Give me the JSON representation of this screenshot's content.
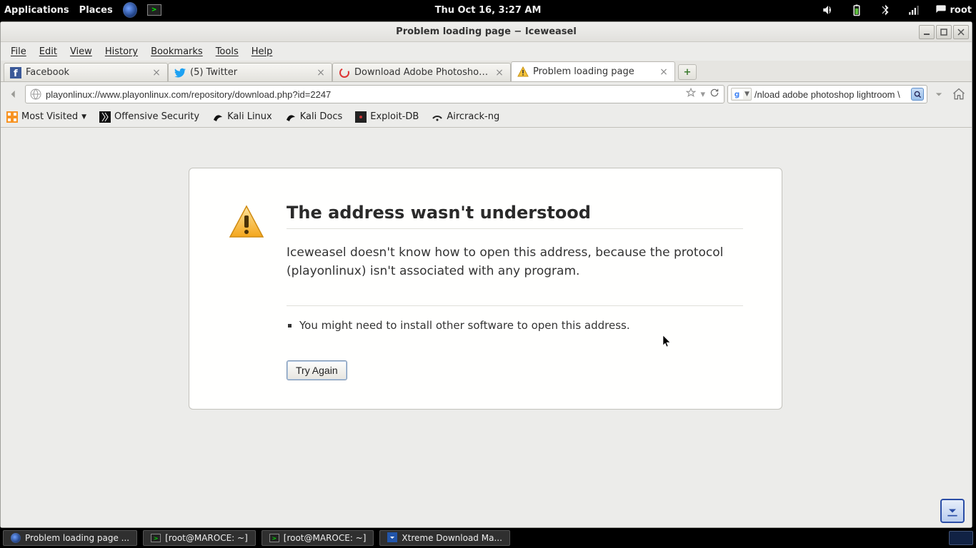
{
  "gnome": {
    "applications": "Applications",
    "places": "Places",
    "clock": "Thu Oct 16,  3:27 AM",
    "user": "root"
  },
  "window": {
    "title": "Problem loading page − Iceweasel"
  },
  "menus": [
    "File",
    "Edit",
    "View",
    "History",
    "Bookmarks",
    "Tools",
    "Help"
  ],
  "tabs": [
    {
      "label": "Facebook",
      "icon": "facebook"
    },
    {
      "label": "(5) Twitter",
      "icon": "twitter"
    },
    {
      "label": "Download Adobe Photoshop...",
      "icon": "adobe"
    },
    {
      "label": "Problem loading page",
      "icon": "warning",
      "active": true
    }
  ],
  "navbar": {
    "url": "playonlinux://www.playonlinux.com/repository/download.php?id=2247",
    "search_value": "/nload adobe photoshop lightroom \\"
  },
  "bookmarks": [
    {
      "label": "Most Visited",
      "icon": "most-visited",
      "menu": true
    },
    {
      "label": "Offensive Security",
      "icon": "offsec"
    },
    {
      "label": "Kali Linux",
      "icon": "kali"
    },
    {
      "label": "Kali Docs",
      "icon": "kali"
    },
    {
      "label": "Exploit-DB",
      "icon": "exploitdb"
    },
    {
      "label": "Aircrack-ng",
      "icon": "aircrack"
    }
  ],
  "error": {
    "title": "The address wasn't understood",
    "description": "Iceweasel doesn't know how to open this address, because the protocol (playonlinux) isn't associated with any program.",
    "bullet": "You might need to install other software to open this address.",
    "try_again": "Try Again"
  },
  "taskbar": [
    {
      "label": "Problem loading page ...",
      "icon": "iceweasel"
    },
    {
      "label": "[root@MAROCE: ~]",
      "icon": "terminal"
    },
    {
      "label": "[root@MAROCE: ~]",
      "icon": "terminal"
    },
    {
      "label": "Xtreme Download Ma...",
      "icon": "xdm"
    }
  ]
}
